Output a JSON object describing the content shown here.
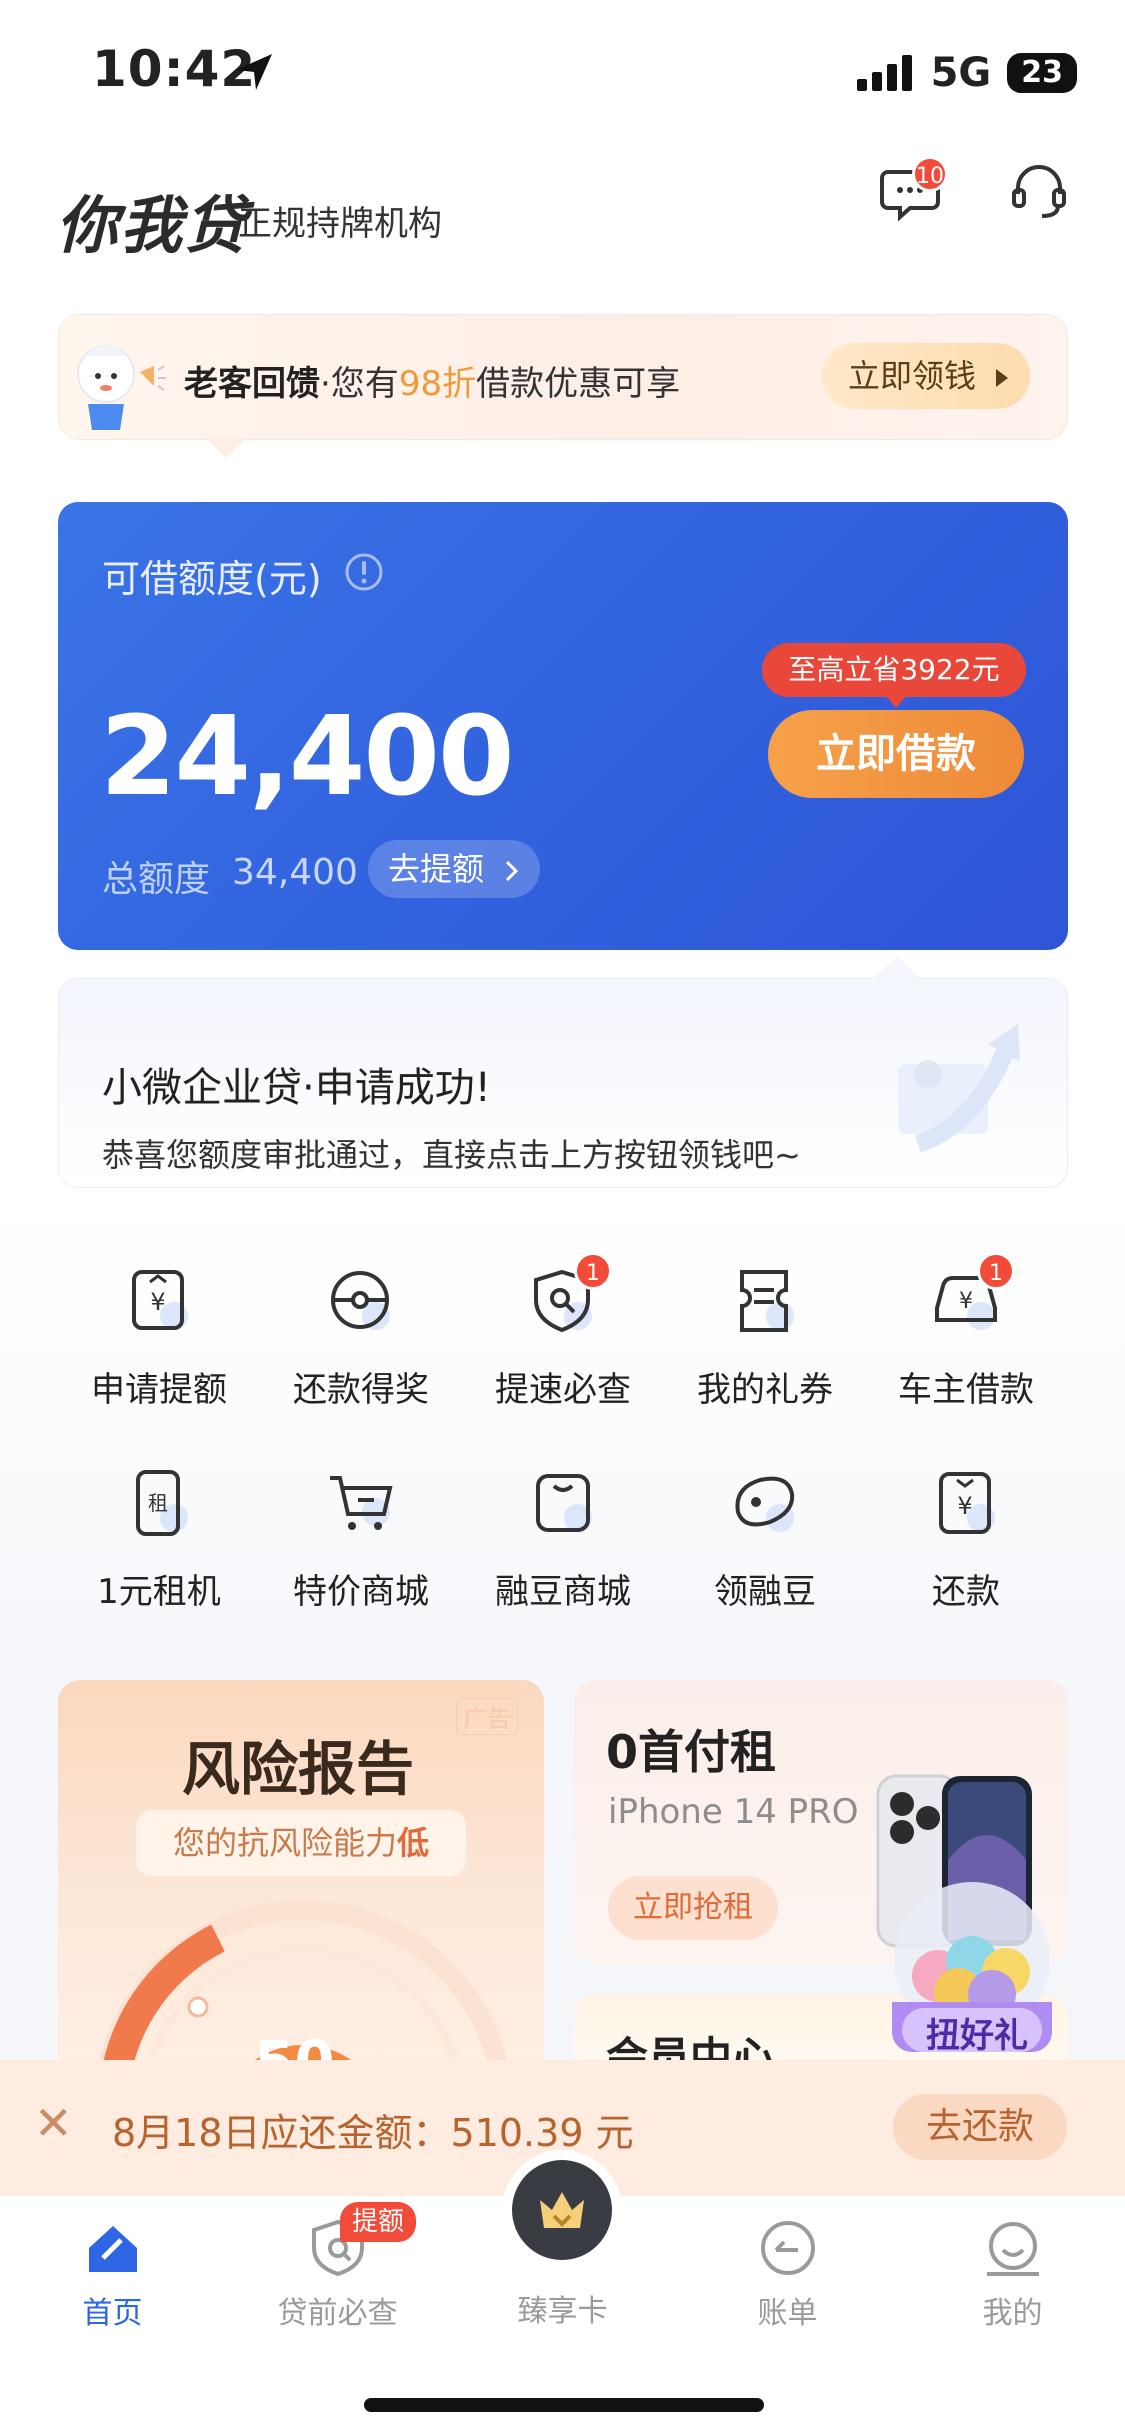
{
  "status_bar": {
    "time": "10:42",
    "network": "5G",
    "battery": "23"
  },
  "header": {
    "logo": "你我贷",
    "subtitle": "正规持牌机构",
    "message_count": "10"
  },
  "banner": {
    "lead": "老客回馈",
    "sep": "·您有",
    "highlight": "98折",
    "rest": "借款优惠可享",
    "button": "立即领钱"
  },
  "credit_card": {
    "title": "可借额度(元)",
    "amount": "24,400",
    "total_label": "总额度",
    "total_value": "34,400",
    "raise_button": "去提额",
    "save_tag": "至高立省3922元",
    "borrow_button": "立即借款"
  },
  "notice": {
    "title": "小微企业贷·申请成功!",
    "desc": "恭喜您额度审批通过，直接点击上方按钮领钱吧~"
  },
  "grid": [
    {
      "label": "申请提额",
      "icon": "yen-card-icon",
      "badge": ""
    },
    {
      "label": "还款得奖",
      "icon": "pokeball-icon",
      "badge": ""
    },
    {
      "label": "提速必查",
      "icon": "shield-search-icon",
      "badge": "1"
    },
    {
      "label": "我的礼券",
      "icon": "coupon-icon",
      "badge": ""
    },
    {
      "label": "车主借款",
      "icon": "car-yen-icon",
      "badge": "1"
    },
    {
      "label": "1元租机",
      "icon": "rent-phone-icon",
      "badge": ""
    },
    {
      "label": "特价商城",
      "icon": "cart-icon",
      "badge": ""
    },
    {
      "label": "融豆商城",
      "icon": "bag-icon",
      "badge": ""
    },
    {
      "label": "领融豆",
      "icon": "bean-icon",
      "badge": ""
    },
    {
      "label": "还款",
      "icon": "repay-yen-icon",
      "badge": ""
    }
  ],
  "risk_card": {
    "ad": "广告",
    "title": "风险报告",
    "pill_prefix": "您的抗风险能力",
    "pill_level": "低",
    "score": "50"
  },
  "rent_card": {
    "title": "0首付租",
    "subtitle": "iPhone 14 PRO",
    "button": "立即抢租"
  },
  "member_card": {
    "title": "会员中心"
  },
  "gift": {
    "label": "扭好礼"
  },
  "repay_bar": {
    "text": "8月18日应还金额：510.39 元",
    "button": "去还款"
  },
  "tabbar": {
    "tabs": [
      {
        "label": "首页"
      },
      {
        "label": "贷前必查"
      },
      {
        "label": "臻享卡"
      },
      {
        "label": "账单"
      },
      {
        "label": "我的"
      }
    ],
    "badge": "提额"
  },
  "colors": {
    "primary": "#2f66e6",
    "orange": "#ee8a37",
    "red_badge": "#f24b3a"
  }
}
